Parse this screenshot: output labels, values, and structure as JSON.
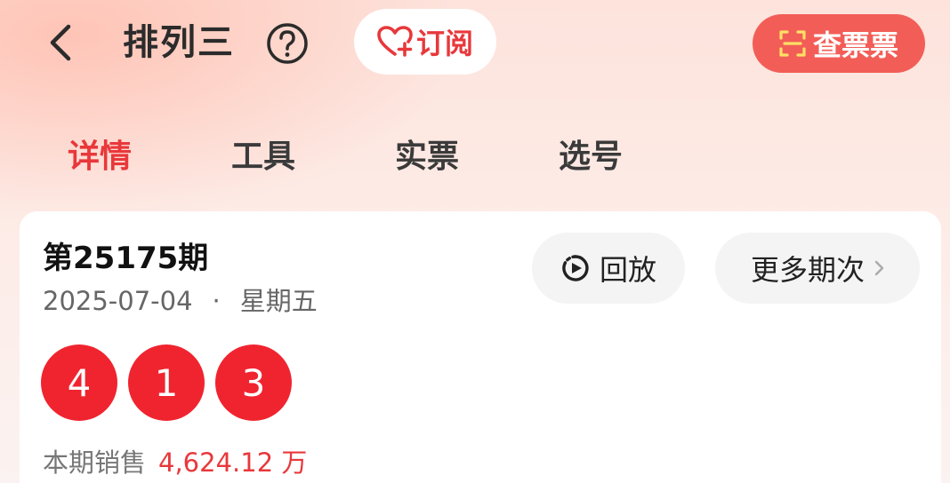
{
  "header": {
    "title": "排列三",
    "subscribe_label": "订阅",
    "check_ticket_label": "查票票",
    "icons": {
      "back": "chevron-left-icon",
      "help": "question-circle-icon",
      "subscribe": "heart-plus-icon",
      "scan": "scan-icon"
    }
  },
  "tabs": [
    {
      "label": "详情",
      "active": true
    },
    {
      "label": "工具",
      "active": false
    },
    {
      "label": "实票",
      "active": false
    },
    {
      "label": "选号",
      "active": false
    }
  ],
  "draw": {
    "issue": "第25175期",
    "date": "2025-07-04",
    "separator": "·",
    "weekday": "星期五",
    "replay_label": "回放",
    "more_label": "更多期次",
    "numbers": [
      "4",
      "1",
      "3"
    ],
    "sales_label": "本期销售",
    "sales_value": "4,624.12 万"
  },
  "colors": {
    "accent": "#e8383b",
    "ball": "#f0242f",
    "check_button": "#f25e57"
  }
}
